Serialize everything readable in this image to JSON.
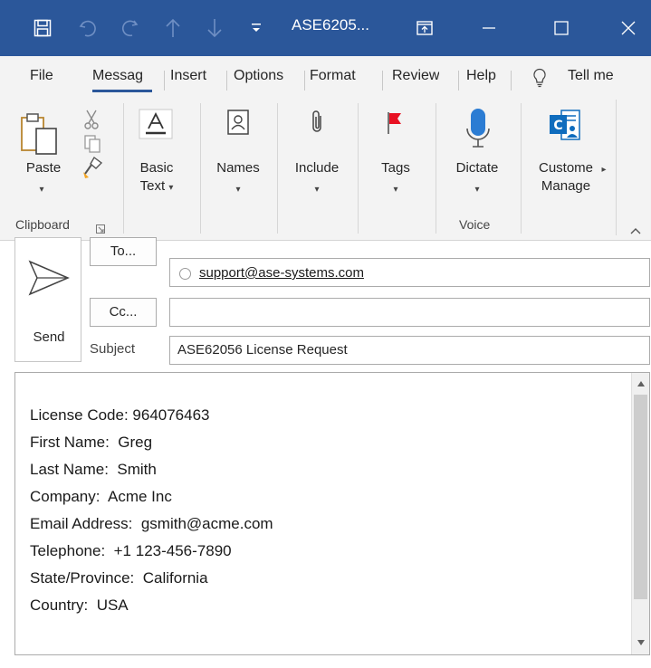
{
  "window": {
    "title": "ASE6205..."
  },
  "tabs": [
    {
      "label": "File"
    },
    {
      "label": "Messag"
    },
    {
      "label": "Insert"
    },
    {
      "label": "Options"
    },
    {
      "label": "Format"
    },
    {
      "label": "Review"
    },
    {
      "label": "Help"
    },
    {
      "label": "Tell me"
    }
  ],
  "ribbon": {
    "paste": "Paste",
    "basic_text": {
      "line1": "Basic",
      "line2": "Text"
    },
    "names": "Names",
    "include": "Include",
    "tags": "Tags",
    "dictate": "Dictate",
    "customer_manager": {
      "line1": "Custome",
      "line2": "Manage"
    },
    "groups": {
      "clipboard": "Clipboard",
      "voice": "Voice"
    }
  },
  "compose": {
    "send": "Send",
    "to_button": "To...",
    "cc_button": "Cc...",
    "subject_label": "Subject",
    "to_value": "support@ase-systems.com",
    "cc_value": "",
    "subject_value": "ASE62056 License Request"
  },
  "body": {
    "lines": [
      "License Code: 964076463",
      "",
      "First Name:  Greg",
      "Last Name:  Smith",
      "Company:  Acme Inc",
      "Email Address:  gsmith@acme.com",
      "Telephone:  +1 123-456-7890",
      "State/Province:  California",
      "Country:  USA"
    ]
  },
  "colors": {
    "title_bar": "#2b579a",
    "ribbon_bg": "#f3f3f3",
    "tag_flag": "#e81123",
    "mic": "#2b7cd3",
    "crm_icon": "#0f6cbd"
  }
}
